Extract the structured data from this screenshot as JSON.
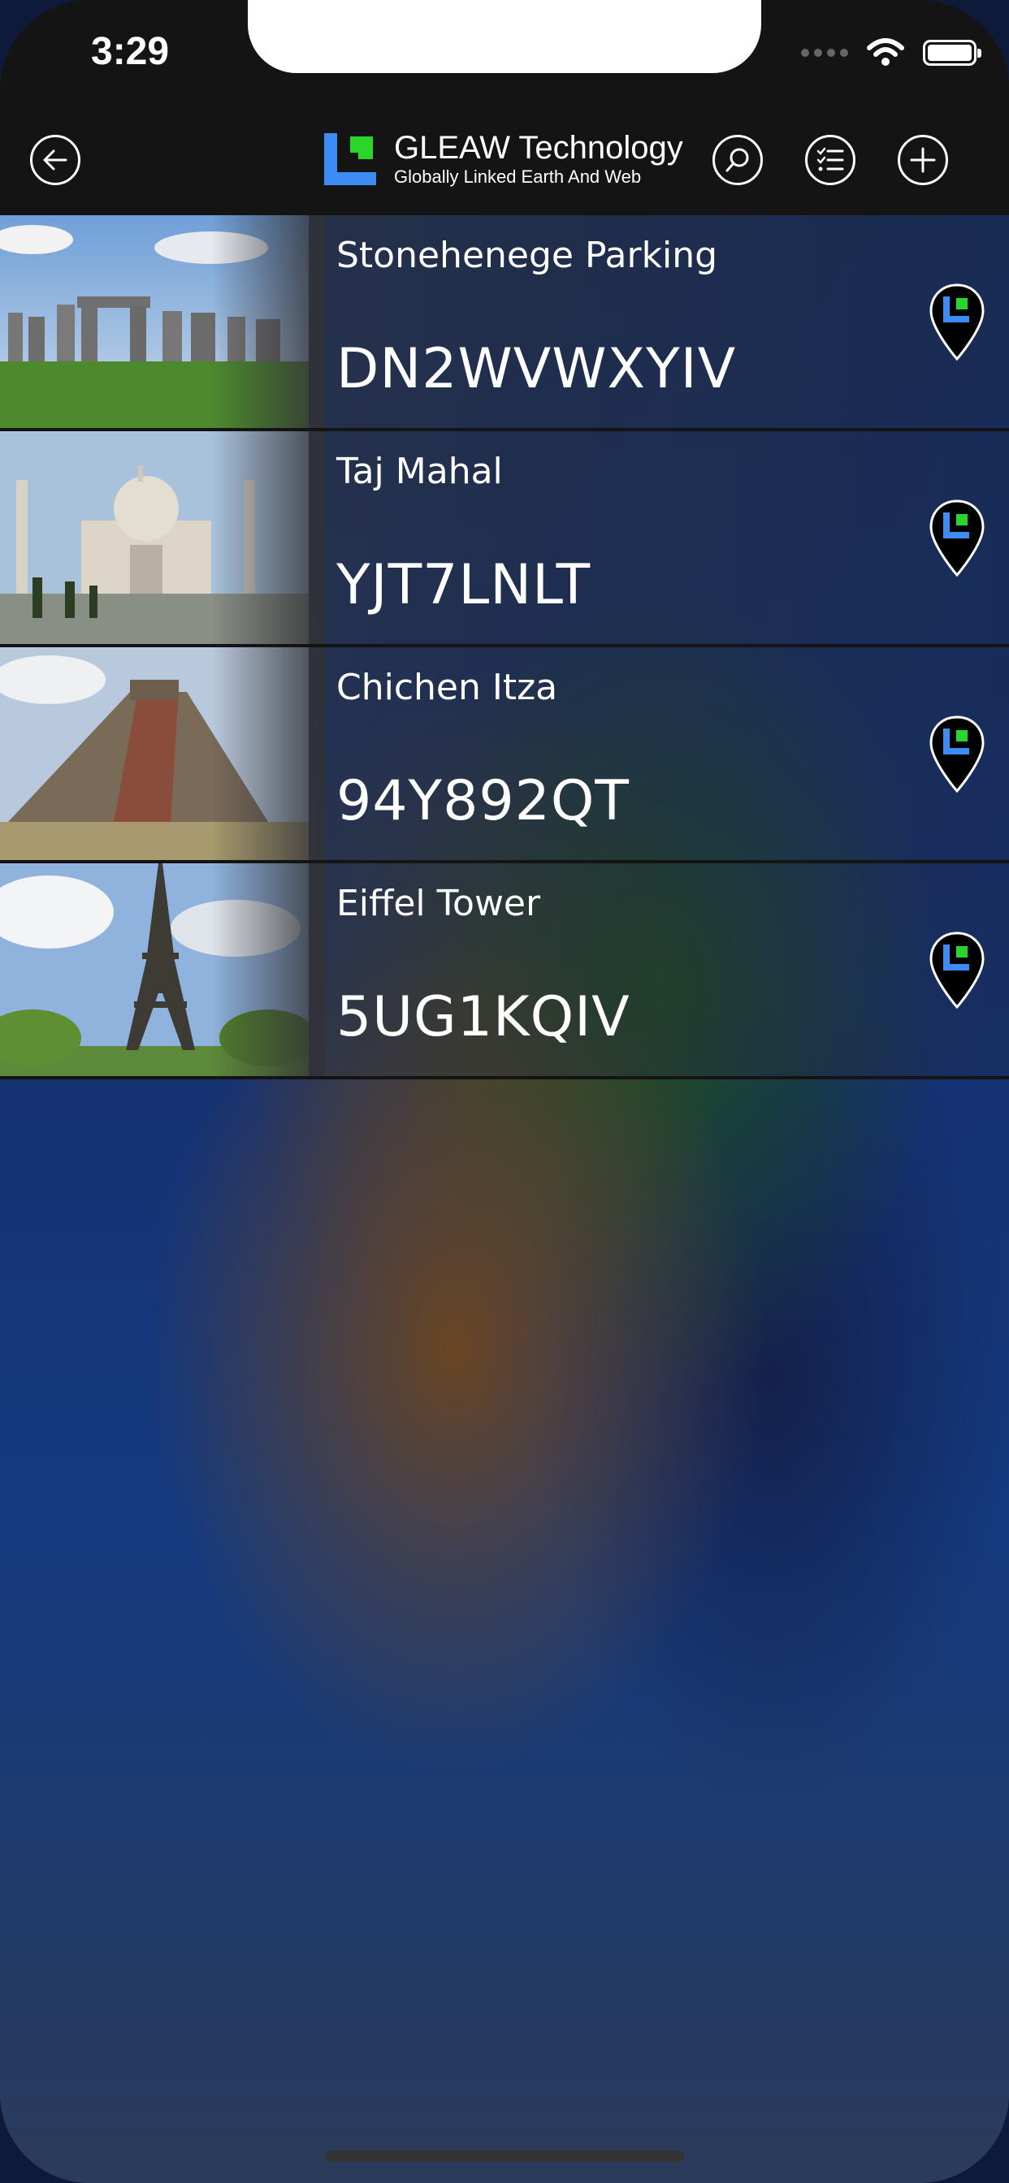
{
  "status_bar": {
    "time": "3:29"
  },
  "header": {
    "title": "GLEAW Technology",
    "subtitle": "Globally Linked Earth And Web",
    "icons": [
      "back-arrow-icon",
      "search-icon",
      "checklist-icon",
      "plus-icon"
    ]
  },
  "places": [
    {
      "name": "Stonehenege Parking",
      "code": "DN2WVWXYIV",
      "image": "stonehenge"
    },
    {
      "name": "Taj Mahal",
      "code": "YJT7LNLT",
      "image": "taj-mahal"
    },
    {
      "name": "Chichen Itza",
      "code": "94Y892QT",
      "image": "chichen-itza"
    },
    {
      "name": "Eiffel Tower",
      "code": "5UG1KQIV",
      "image": "eiffel-tower"
    }
  ],
  "colors": {
    "brand_blue": "#3d8cf5",
    "brand_green": "#2bd62b",
    "header_bg": "#141414"
  }
}
